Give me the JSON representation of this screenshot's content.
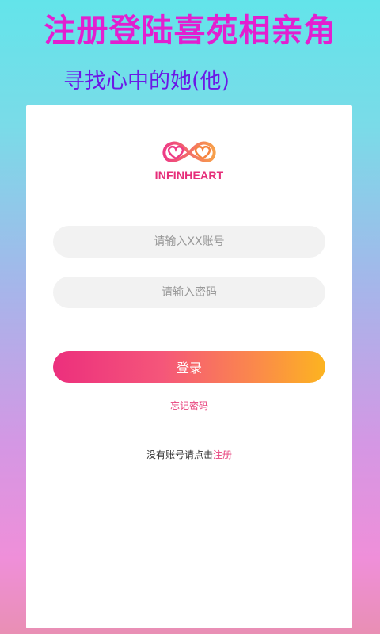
{
  "banner": {
    "title": "注册登陆喜苑相亲角",
    "subtitle": "寻找心中的她(他)"
  },
  "logo": {
    "icon": "infinity-heart-logo",
    "text": "INFINHEART"
  },
  "form": {
    "account_placeholder": "请输入XX账号",
    "password_placeholder": "请输入密码",
    "login_label": "登录",
    "forgot_label": "忘记密码",
    "register_prompt": "没有账号请点击",
    "register_label": "注册"
  },
  "colors": {
    "title": "#e21fd0",
    "subtitle": "#6b18e6",
    "accent": "#e8437e",
    "button_start": "#ec2f7d",
    "button_end": "#fcb420"
  }
}
